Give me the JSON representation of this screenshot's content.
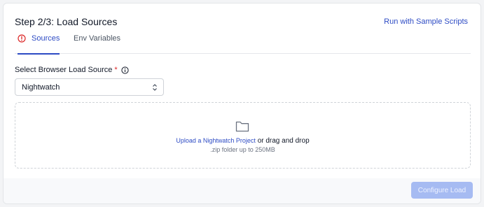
{
  "header": {
    "title": "Step 2/3: Load Sources",
    "sample_link": "Run with Sample Scripts"
  },
  "tabs": [
    {
      "label": "Sources",
      "icon": "alert-circle-icon",
      "active": true
    },
    {
      "label": "Env Variables",
      "active": false
    }
  ],
  "source_field": {
    "label": "Select Browser Load Source",
    "required_marker": "*",
    "selected_value": "Nightwatch"
  },
  "dropzone": {
    "upload_link": "Upload a Nightwatch Project",
    "upload_rest": "or drag and drop",
    "hint": ".zip folder up to 250MB"
  },
  "footer": {
    "configure_label": "Configure Load"
  },
  "colors": {
    "accent": "#2d4bc4",
    "required": "#dc2626",
    "button_disabled": "#a6bbf2"
  }
}
